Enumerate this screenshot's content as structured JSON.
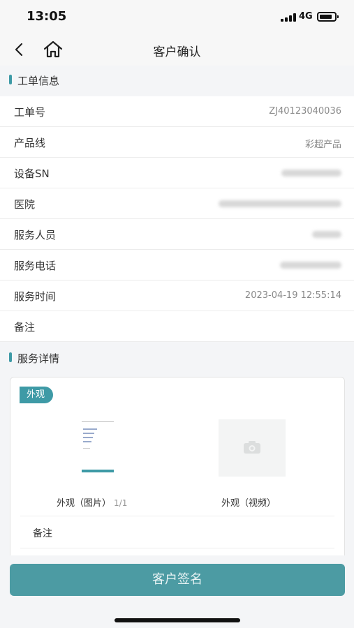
{
  "status": {
    "time": "13:05",
    "network": "4G"
  },
  "nav": {
    "title": "客户确认"
  },
  "sections": {
    "order_info": "工单信息",
    "service_detail": "服务详情"
  },
  "fields": [
    {
      "label": "工单号",
      "value": "ZJ40123040036"
    },
    {
      "label": "产品线",
      "value": "彩超产品"
    },
    {
      "label": "设备SN",
      "value": ""
    },
    {
      "label": "医院",
      "value": ""
    },
    {
      "label": "服务人员",
      "value": ""
    },
    {
      "label": "服务电话",
      "value": ""
    },
    {
      "label": "服务时间",
      "value": "2023-04-19 12:55:14"
    },
    {
      "label": "备注",
      "value": ""
    }
  ],
  "detail": {
    "tag": "外观",
    "photo_caption": "外观（图片）",
    "photo_count": "1/1",
    "video_caption": "外观（视频）",
    "note_label": "备注"
  },
  "actions": {
    "sign": "客户签名"
  },
  "colors": {
    "accent": "#3e9aa6",
    "button": "#4c9ba3"
  }
}
